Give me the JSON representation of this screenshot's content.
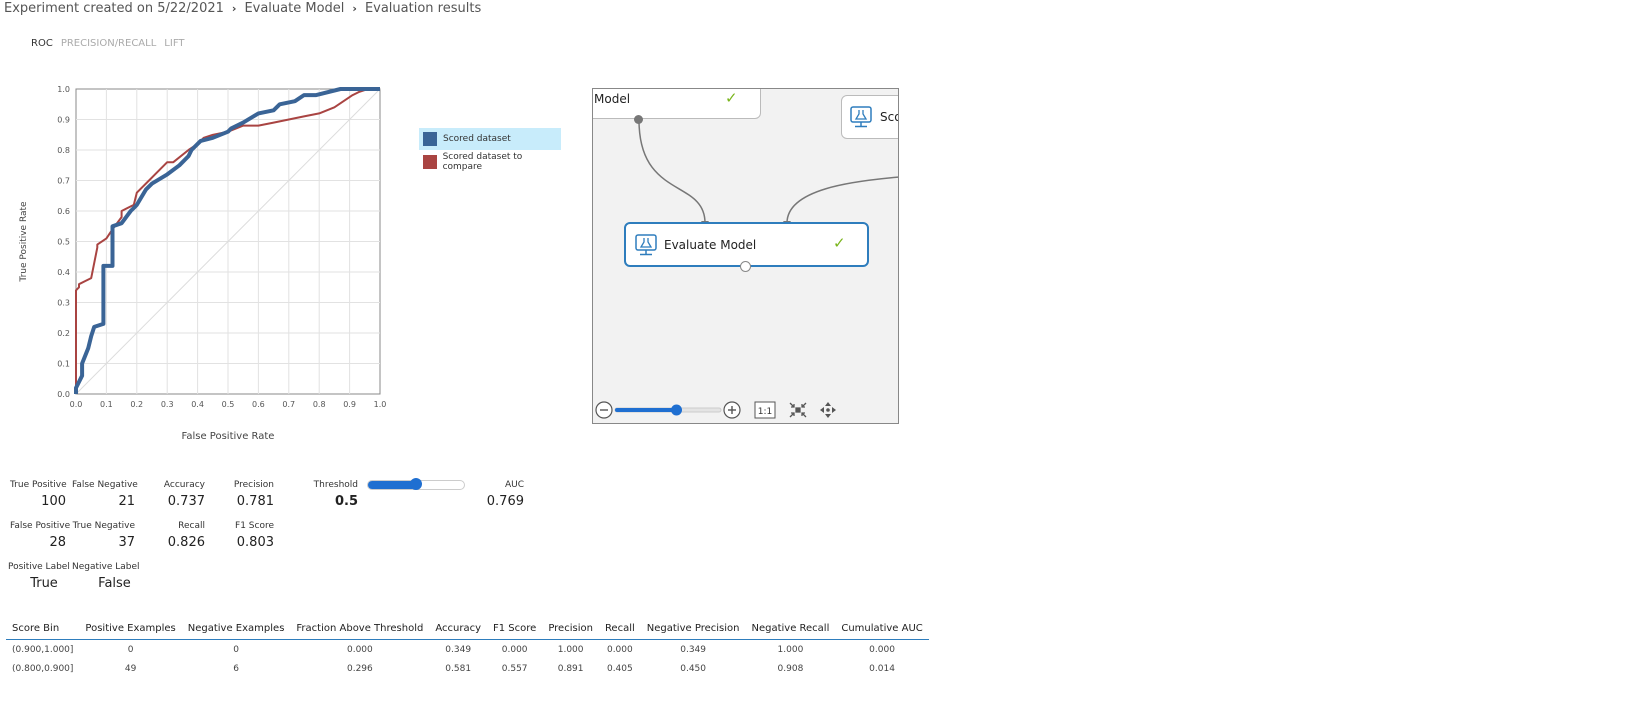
{
  "breadcrumb": [
    "Experiment created on 5/22/2021",
    "Evaluate Model",
    "Evaluation results"
  ],
  "tabs": {
    "roc": "ROC",
    "pr": "PRECISION/RECALL",
    "lift": "LIFT"
  },
  "chart_data": {
    "type": "line",
    "xlabel": "False Positive Rate",
    "ylabel": "True Positive Rate",
    "xlim": [
      0,
      1
    ],
    "ylim": [
      0,
      1
    ],
    "xticks": [
      "0.0",
      "0.1",
      "0.2",
      "0.3",
      "0.4",
      "0.5",
      "0.6",
      "0.7",
      "0.8",
      "0.9",
      "1.0"
    ],
    "yticks": [
      "0.0",
      "0.1",
      "0.2",
      "0.3",
      "0.4",
      "0.5",
      "0.6",
      "0.7",
      "0.8",
      "0.9",
      "1.0"
    ],
    "grid": true,
    "legend_position": "right",
    "series": [
      {
        "name": "Scored dataset",
        "color": "#3a6496",
        "x": [
          0.0,
          0.0,
          0.02,
          0.02,
          0.04,
          0.05,
          0.06,
          0.09,
          0.09,
          0.12,
          0.12,
          0.15,
          0.18,
          0.19,
          0.2,
          0.23,
          0.25,
          0.25,
          0.3,
          0.34,
          0.37,
          0.38,
          0.41,
          0.45,
          0.5,
          0.51,
          0.55,
          0.6,
          0.65,
          0.67,
          0.72,
          0.75,
          0.79,
          0.87,
          0.9,
          0.93,
          0.96,
          1.0
        ],
        "y": [
          0.0,
          0.02,
          0.06,
          0.1,
          0.15,
          0.19,
          0.22,
          0.23,
          0.42,
          0.42,
          0.55,
          0.56,
          0.6,
          0.61,
          0.62,
          0.67,
          0.69,
          0.69,
          0.72,
          0.75,
          0.78,
          0.8,
          0.83,
          0.84,
          0.86,
          0.87,
          0.89,
          0.92,
          0.93,
          0.95,
          0.96,
          0.98,
          0.98,
          1.0,
          1.0,
          1.0,
          1.0,
          1.0
        ]
      },
      {
        "name": "Scored dataset to compare",
        "color": "#a94442",
        "x": [
          0.0,
          0.0,
          0.01,
          0.01,
          0.03,
          0.05,
          0.07,
          0.07,
          0.1,
          0.12,
          0.15,
          0.15,
          0.19,
          0.2,
          0.24,
          0.26,
          0.3,
          0.32,
          0.37,
          0.4,
          0.42,
          0.45,
          0.5,
          0.55,
          0.6,
          0.65,
          0.7,
          0.75,
          0.8,
          0.85,
          0.88,
          0.91,
          0.93,
          0.96,
          1.0
        ],
        "y": [
          0.0,
          0.34,
          0.35,
          0.36,
          0.37,
          0.38,
          0.48,
          0.49,
          0.51,
          0.54,
          0.58,
          0.6,
          0.62,
          0.66,
          0.7,
          0.72,
          0.76,
          0.76,
          0.8,
          0.82,
          0.84,
          0.85,
          0.86,
          0.88,
          0.88,
          0.89,
          0.9,
          0.91,
          0.92,
          0.94,
          0.96,
          0.98,
          0.99,
          1.0,
          1.0
        ]
      }
    ]
  },
  "canvas": {
    "top_node_label": "Model",
    "score_node_label": "Sco",
    "evaluate_node_label": "Evaluate Model",
    "zoom_fit_label": "1:1",
    "zoom_level": 0.58
  },
  "metrics": {
    "true_positive": {
      "label": "True Positive",
      "value": "100"
    },
    "false_negative": {
      "label": "False Negative",
      "value": "21"
    },
    "accuracy": {
      "label": "Accuracy",
      "value": "0.737"
    },
    "precision": {
      "label": "Precision",
      "value": "0.781"
    },
    "threshold": {
      "label": "Threshold",
      "value": "0.5"
    },
    "auc": {
      "label": "AUC",
      "value": "0.769"
    },
    "false_positive": {
      "label": "False Positive",
      "value": "28"
    },
    "true_negative": {
      "label": "True Negative",
      "value": "37"
    },
    "recall": {
      "label": "Recall",
      "value": "0.826"
    },
    "f1": {
      "label": "F1 Score",
      "value": "0.803"
    },
    "positive_label": {
      "label": "Positive Label",
      "value": "True"
    },
    "negative_label": {
      "label": "Negative Label",
      "value": "False"
    }
  },
  "table": {
    "headers": [
      "Score Bin",
      "Positive Examples",
      "Negative Examples",
      "Fraction Above Threshold",
      "Accuracy",
      "F1 Score",
      "Precision",
      "Recall",
      "Negative Precision",
      "Negative Recall",
      "Cumulative AUC"
    ],
    "rows": [
      [
        "(0.900,1.000]",
        "0",
        "0",
        "0.000",
        "0.349",
        "0.000",
        "1.000",
        "0.000",
        "0.349",
        "1.000",
        "0.000"
      ],
      [
        "(0.800,0.900]",
        "49",
        "6",
        "0.296",
        "0.581",
        "0.557",
        "0.891",
        "0.405",
        "0.450",
        "0.908",
        "0.014"
      ]
    ]
  }
}
